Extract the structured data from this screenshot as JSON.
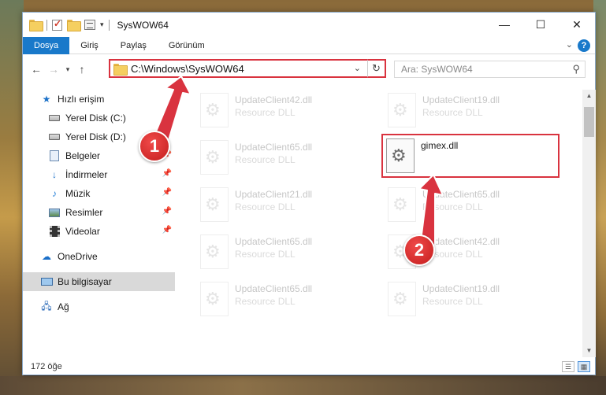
{
  "window": {
    "title": "SysWOW64",
    "controls": {
      "minimize": "—",
      "maximize": "☐",
      "close": "✕"
    }
  },
  "ribbon": {
    "tabs": [
      {
        "label": "Dosya",
        "active": true
      },
      {
        "label": "Giriş",
        "active": false
      },
      {
        "label": "Paylaş",
        "active": false
      },
      {
        "label": "Görünüm",
        "active": false
      }
    ],
    "help": "?"
  },
  "navigation": {
    "address": "C:\\Windows\\SysWOW64",
    "search_placeholder": "Ara: SysWOW64"
  },
  "sidebar": {
    "items": [
      {
        "label": "Hızlı erişim",
        "icon": "star-icon",
        "pinned": false
      },
      {
        "label": "Yerel Disk (C:)",
        "icon": "drive-icon",
        "pinned": true
      },
      {
        "label": "Yerel Disk (D:)",
        "icon": "drive-icon",
        "pinned": true
      },
      {
        "label": "Belgeler",
        "icon": "documents-icon",
        "pinned": true
      },
      {
        "label": "İndirmeler",
        "icon": "download-icon",
        "pinned": true
      },
      {
        "label": "Müzik",
        "icon": "music-icon",
        "pinned": true
      },
      {
        "label": "Resimler",
        "icon": "pictures-icon",
        "pinned": true
      },
      {
        "label": "Videolar",
        "icon": "videos-icon",
        "pinned": true
      },
      {
        "label": "OneDrive",
        "icon": "cloud-icon",
        "pinned": false
      },
      {
        "label": "Bu bilgisayar",
        "icon": "computer-icon",
        "pinned": false,
        "selected": true
      },
      {
        "label": "Ağ",
        "icon": "network-icon",
        "pinned": false
      }
    ]
  },
  "files": [
    {
      "name": "UpdateClient42.dll",
      "type": "Resource DLL"
    },
    {
      "name": "UpdateClient19.dll",
      "type": "Resource DLL"
    },
    {
      "name": "UpdateClient65.dll",
      "type": "Resource DLL"
    },
    {
      "name": "gimex.dll",
      "type": "",
      "highlighted": true
    },
    {
      "name": "UpdateClient21.dll",
      "type": "Resource DLL"
    },
    {
      "name": "UpdateClient65.dll",
      "type": "Resource DLL"
    },
    {
      "name": "UpdateClient65.dll",
      "type": "Resource DLL"
    },
    {
      "name": "UpdateClient42.dll",
      "type": "Resource DLL"
    },
    {
      "name": "UpdateClient65.dll",
      "type": "Resource DLL"
    },
    {
      "name": "UpdateClient19.dll",
      "type": "Resource DLL"
    }
  ],
  "status": {
    "item_count": "172 öğe"
  },
  "annotations": {
    "step1": "1",
    "step2": "2",
    "color": "#d9333f"
  }
}
